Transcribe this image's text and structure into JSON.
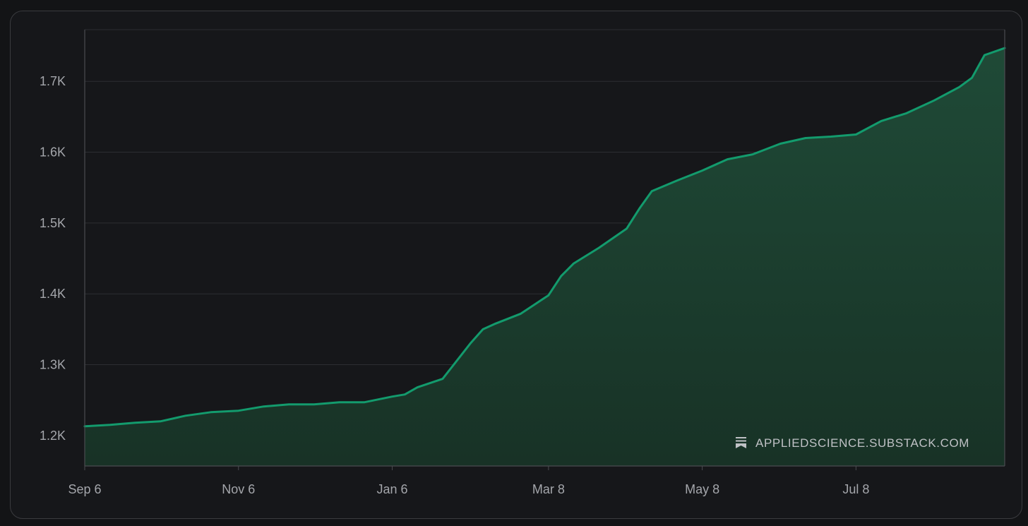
{
  "watermark": {
    "text": "APPLIEDSCIENCE.SUBSTACK.COM",
    "icon": "substack-bookmark-icon"
  },
  "colors": {
    "line": "#139b6d",
    "fill_top": "#1f4a37",
    "fill_bottom": "#183226",
    "grid": "#2c2e32",
    "axis": "#4a4c50",
    "background": "#16171a"
  },
  "chart_data": {
    "type": "area",
    "title": "",
    "xlabel": "",
    "ylabel": "",
    "x_ticks": [
      "Sep 6",
      "Nov 6",
      "Jan 6",
      "Mar 8",
      "May 8",
      "Jul 8"
    ],
    "y_ticks": [
      "1.2K",
      "1.3K",
      "1.4K",
      "1.5K",
      "1.6K",
      "1.7K"
    ],
    "y_tick_values": [
      1200,
      1300,
      1400,
      1500,
      1600,
      1700
    ],
    "ylim": [
      1157,
      1773
    ],
    "x_range": [
      "Sep 6",
      "Sep 5"
    ],
    "grid": true,
    "series": [
      {
        "x": [
          "Sep 6",
          "Sep 16",
          "Sep 26",
          "Oct 6",
          "Oct 16",
          "Oct 26",
          "Nov 6",
          "Nov 16",
          "Nov 26",
          "Dec 6",
          "Dec 16",
          "Dec 26",
          "Jan 6",
          "Jan 11",
          "Jan 16",
          "Jan 26",
          "Feb 6",
          "Feb 11",
          "Feb 16",
          "Feb 26",
          "Mar 8",
          "Mar 13",
          "Mar 18",
          "Mar 28",
          "Apr 8",
          "Apr 13",
          "Apr 18",
          "Apr 28",
          "May 8",
          "May 18",
          "May 28",
          "Jun 8",
          "Jun 18",
          "Jun 28",
          "Jul 8",
          "Jul 18",
          "Jul 28",
          "Aug 8",
          "Aug 18",
          "Aug 23",
          "Aug 28",
          "Sep 5"
        ],
        "values": [
          1213,
          1215,
          1218,
          1220,
          1228,
          1233,
          1235,
          1241,
          1244,
          1244,
          1247,
          1247,
          1255,
          1258,
          1268,
          1280,
          1330,
          1350,
          1358,
          1372,
          1398,
          1425,
          1443,
          1465,
          1492,
          1520,
          1545,
          1560,
          1574,
          1590,
          1597,
          1612,
          1620,
          1622,
          1625,
          1644,
          1655,
          1673,
          1692,
          1705,
          1737,
          1747
        ]
      }
    ]
  }
}
